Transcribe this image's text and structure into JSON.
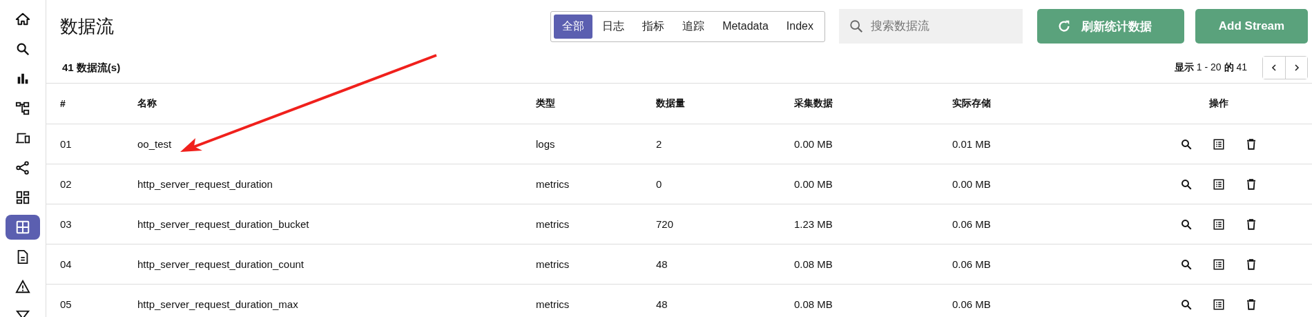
{
  "sidebar": {
    "items": [
      {
        "selected": false
      },
      {
        "selected": false
      },
      {
        "selected": false
      },
      {
        "selected": false
      },
      {
        "selected": false
      },
      {
        "selected": false
      },
      {
        "selected": false
      },
      {
        "selected": true
      },
      {
        "selected": false
      },
      {
        "selected": false
      },
      {
        "selected": false
      }
    ]
  },
  "title": "数据流",
  "tabs": [
    {
      "label": "全部",
      "selected": true
    },
    {
      "label": "日志",
      "selected": false
    },
    {
      "label": "指标",
      "selected": false
    },
    {
      "label": "追踪",
      "selected": false
    },
    {
      "label": "Metadata",
      "selected": false
    },
    {
      "label": "Index",
      "selected": false
    }
  ],
  "search": {
    "placeholder": "搜索数据流"
  },
  "buttons": {
    "refresh": "刷新统计数据",
    "add": "Add Stream"
  },
  "count": "41 数据流(s)",
  "pagination": {
    "prefix": "显示",
    "range": "1 - 20",
    "of": "的",
    "total": "41"
  },
  "table": {
    "columns": [
      "#",
      "名称",
      "类型",
      "数据量",
      "采集数据",
      "实际存储",
      "操作"
    ],
    "rows": [
      {
        "num": "01",
        "name": "oo_test",
        "type": "logs",
        "docs": "2",
        "ingested": "0.00 MB",
        "storage": "0.01 MB"
      },
      {
        "num": "02",
        "name": "http_server_request_duration",
        "type": "metrics",
        "docs": "0",
        "ingested": "0.00 MB",
        "storage": "0.00 MB"
      },
      {
        "num": "03",
        "name": "http_server_request_duration_bucket",
        "type": "metrics",
        "docs": "720",
        "ingested": "1.23 MB",
        "storage": "0.06 MB"
      },
      {
        "num": "04",
        "name": "http_server_request_duration_count",
        "type": "metrics",
        "docs": "48",
        "ingested": "0.08 MB",
        "storage": "0.06 MB"
      },
      {
        "num": "05",
        "name": "http_server_request_duration_max",
        "type": "metrics",
        "docs": "48",
        "ingested": "0.08 MB",
        "storage": "0.06 MB"
      }
    ]
  }
}
